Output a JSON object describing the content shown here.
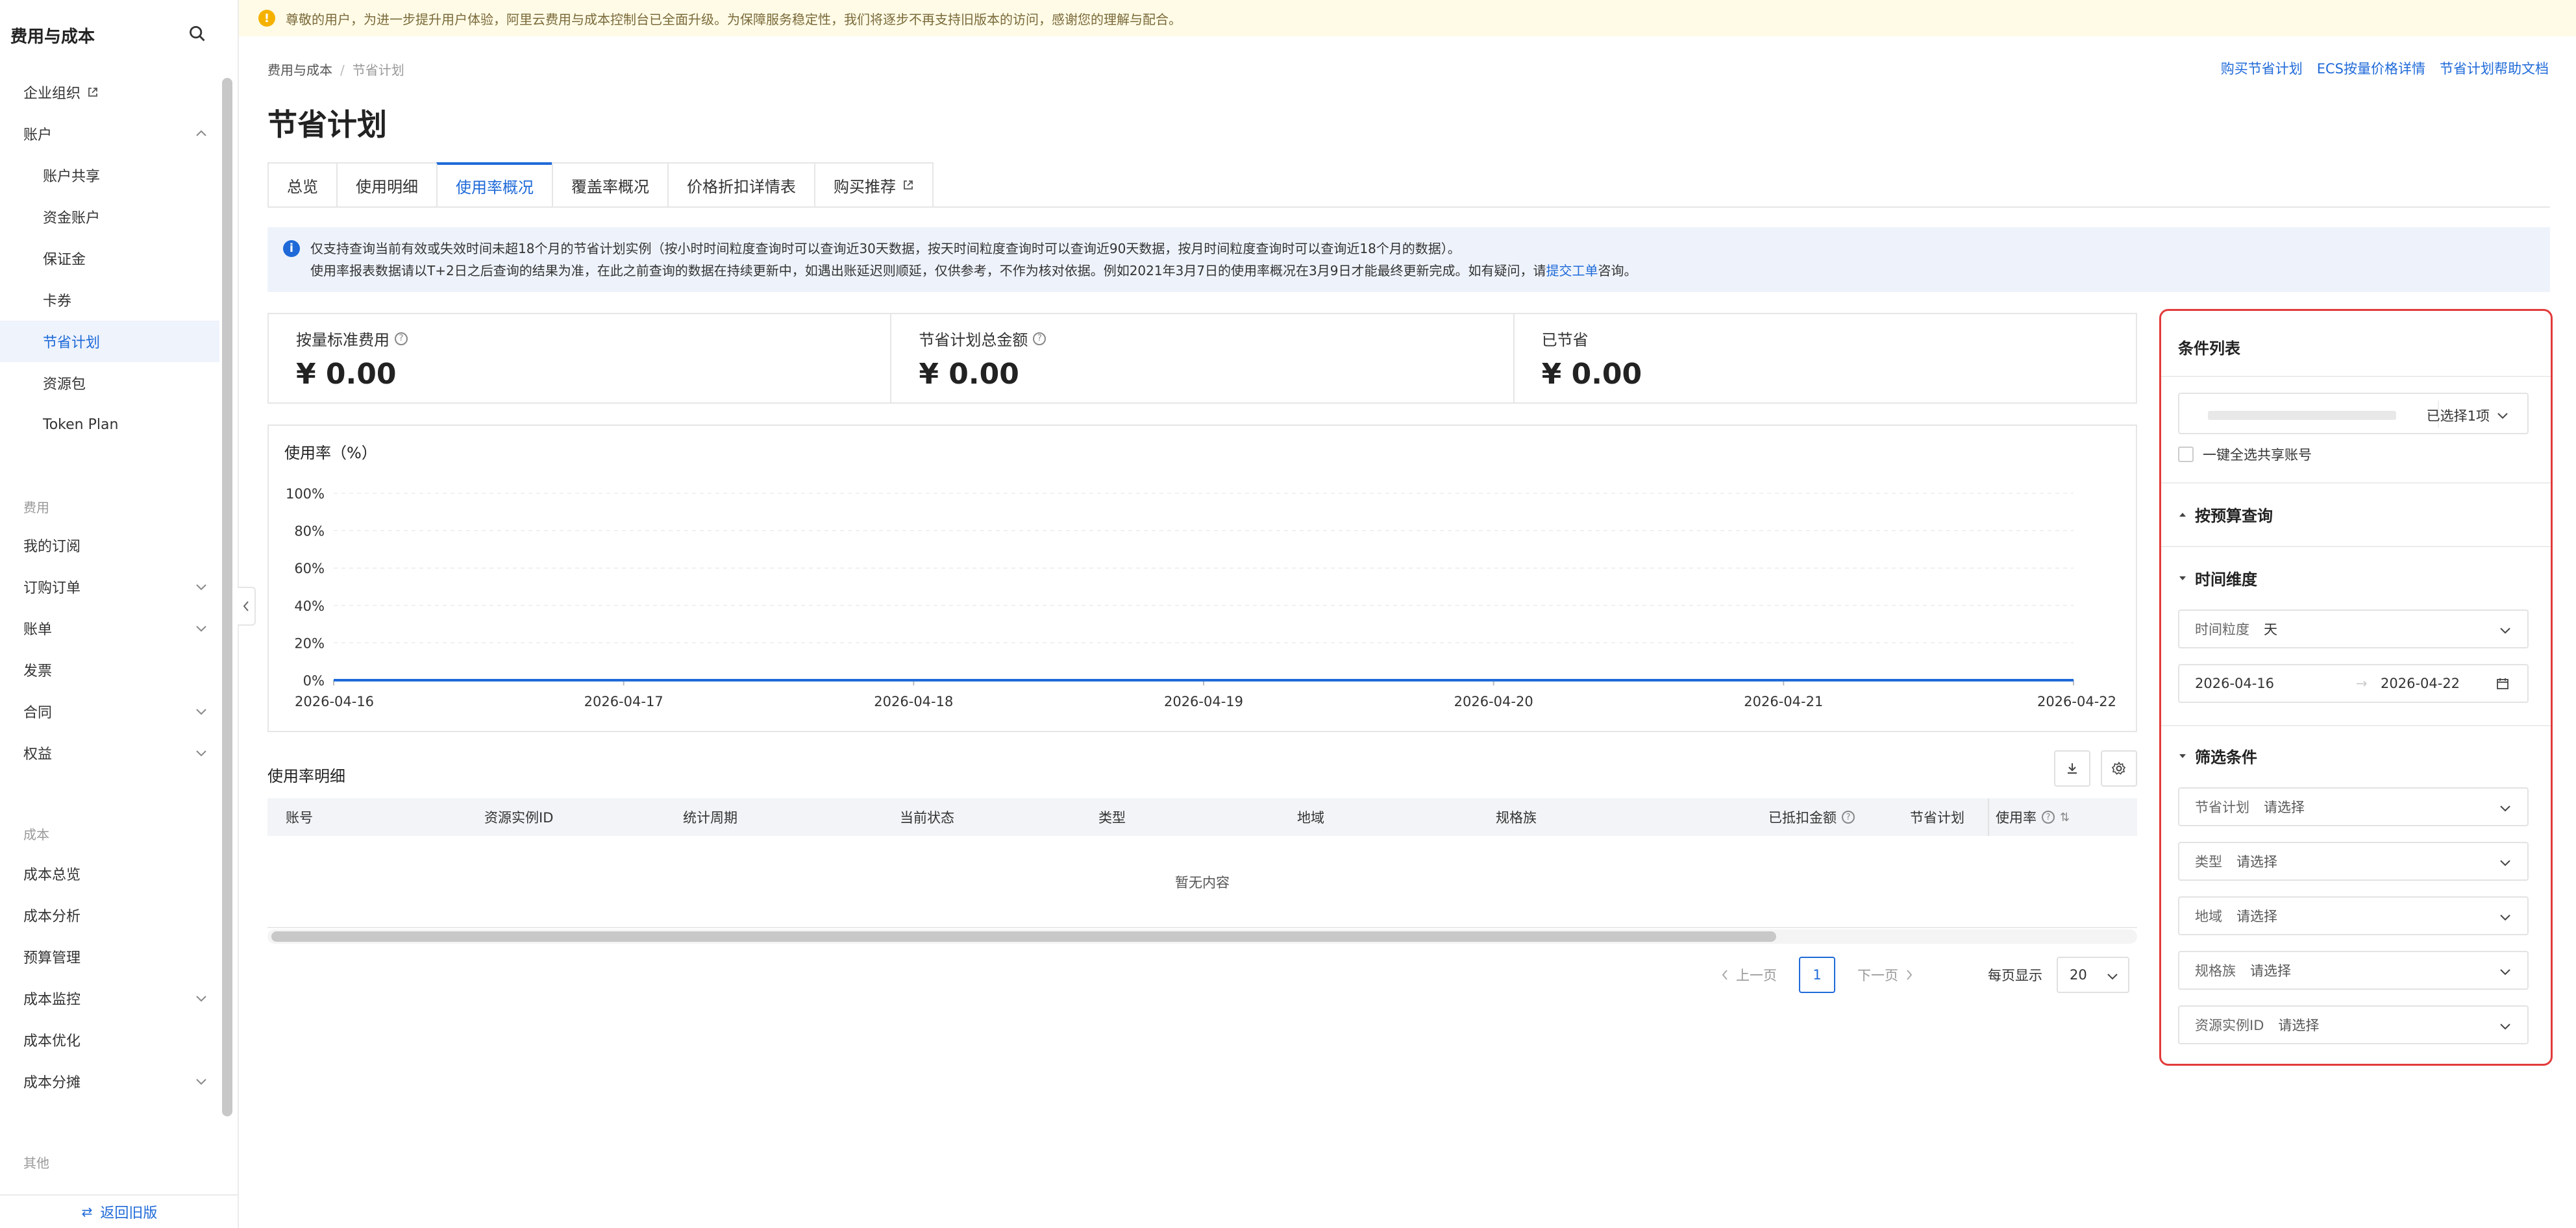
{
  "sidebar": {
    "title": "费用与成本",
    "items": [
      {
        "label": "企业组织",
        "external": true
      },
      {
        "label": "账户",
        "expanded": true
      },
      {
        "label": "账户共享"
      },
      {
        "label": "资金账户"
      },
      {
        "label": "保证金"
      },
      {
        "label": "卡券"
      },
      {
        "label": "节省计划",
        "active": true
      },
      {
        "label": "资源包"
      },
      {
        "label": "Token Plan"
      }
    ],
    "section_fee": "费用",
    "fee_items": [
      {
        "label": "我的订阅"
      },
      {
        "label": "订购订单"
      },
      {
        "label": "账单"
      },
      {
        "label": "发票"
      },
      {
        "label": "合同"
      },
      {
        "label": "权益"
      }
    ],
    "section_cost": "成本",
    "cost_items": [
      {
        "label": "成本总览"
      },
      {
        "label": "成本分析"
      },
      {
        "label": "预算管理"
      },
      {
        "label": "成本监控"
      },
      {
        "label": "成本优化"
      },
      {
        "label": "成本分摊"
      }
    ],
    "section_other": "其他",
    "back_label": "返回旧版"
  },
  "banner": {
    "text": "尊敬的用户，为进一步提升用户体验，阿里云费用与成本控制台已全面升级。为保障服务稳定性，我们将逐步不再支持旧版本的访问，感谢您的理解与配合。"
  },
  "breadcrumb": {
    "root": "费用与成本",
    "current": "节省计划"
  },
  "top_links": [
    "购买节省计划",
    "ECS按量价格详情",
    "节省计划帮助文档"
  ],
  "page_title": "节省计划",
  "tabs": [
    {
      "label": "总览"
    },
    {
      "label": "使用明细"
    },
    {
      "label": "使用率概况",
      "active": true
    },
    {
      "label": "覆盖率概况"
    },
    {
      "label": "价格折扣详情表"
    },
    {
      "label": "购买推荐",
      "external": true
    }
  ],
  "notice": {
    "line1": "仅支持查询当前有效或失效时间未超18个月的节省计划实例（按小时时间粒度查询时可以查询近30天数据，按天时间粒度查询时可以查询近90天数据，按月时间粒度查询时可以查询近18个月的数据）。",
    "line2_pre": "使用率报表数据请以T+2日之后查询的结果为准，在此之前查询的数据在持续更新中，如遇出账延迟则顺延，仅供参考，不作为核对依据。例如2021年3月7日的使用率概况在3月9日才能最终更新完成。如有疑问，请",
    "line2_link": "提交工单",
    "line2_post": "咨询。"
  },
  "stats": [
    {
      "label": "按量标准费用",
      "value": "¥ 0.00",
      "help": true
    },
    {
      "label": "节省计划总金额",
      "value": "¥ 0.00",
      "help": true
    },
    {
      "label": "已节省",
      "value": "¥ 0.00",
      "help": false
    }
  ],
  "chart_data": {
    "type": "line",
    "title": "使用率（%）",
    "xlabel": "",
    "ylabel": "",
    "x": [
      "2026-04-16",
      "2026-04-17",
      "2026-04-18",
      "2026-04-19",
      "2026-04-20",
      "2026-04-21",
      "2026-04-22"
    ],
    "series": [
      {
        "values": [
          0,
          0,
          0,
          0,
          0,
          0,
          0
        ],
        "color": "#1f6ad8"
      }
    ],
    "yticks": [
      "0%",
      "20%",
      "40%",
      "60%",
      "80%",
      "100%"
    ],
    "ylim": [
      0,
      100
    ],
    "grid": true
  },
  "table": {
    "title": "使用率明细",
    "columns": [
      "账号",
      "资源实例ID",
      "统计周期",
      "当前状态",
      "类型",
      "地域",
      "规格族",
      "已抵扣金额",
      "节省计划",
      "使用率"
    ],
    "empty_text": "暂无内容"
  },
  "pagination": {
    "prev": "上一页",
    "current": "1",
    "next": "下一页",
    "page_size_label": "每页显示",
    "page_size": "20"
  },
  "filter": {
    "title": "条件列表",
    "account_selected": "已选择1项",
    "select_all_shared": "一键全选共享账号",
    "section_budget": "按预算查询",
    "section_time": "时间维度",
    "granularity_label": "时间粒度",
    "granularity_value": "天",
    "date_start": "2026-04-16",
    "date_end": "2026-04-22",
    "section_filter": "筛选条件",
    "fields": [
      {
        "label": "节省计划",
        "placeholder": "请选择"
      },
      {
        "label": "类型",
        "placeholder": "请选择"
      },
      {
        "label": "地域",
        "placeholder": "请选择"
      },
      {
        "label": "规格族",
        "placeholder": "请选择"
      },
      {
        "label": "资源实例ID",
        "placeholder": "请选择"
      }
    ]
  },
  "colors": {
    "accent": "#1f6ad8",
    "highlight_border": "#e23b3b",
    "banner_bg": "#fffbe6"
  }
}
